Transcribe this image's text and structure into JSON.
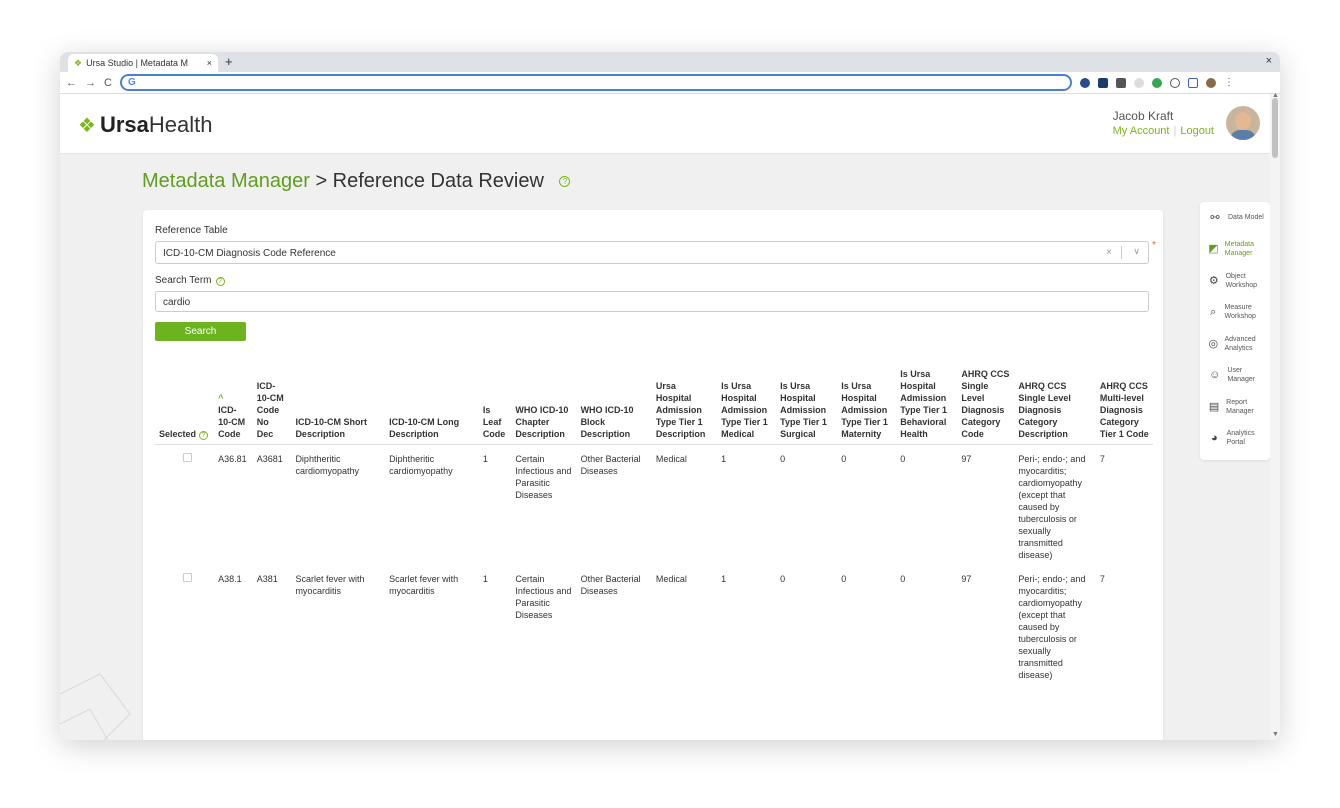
{
  "browser": {
    "tab_title": "Ursa Studio | Metadata M",
    "tab_close": "×",
    "new_tab": "+",
    "window_close": "×",
    "omnibox_text": "G",
    "back": "←",
    "forward": "→",
    "reload": "C"
  },
  "header": {
    "logo_bold": "Ursa",
    "logo_light": "Health",
    "user_name": "Jacob Kraft",
    "my_account": "My Account",
    "separator": "|",
    "logout": "Logout"
  },
  "page": {
    "title_section": "Metadata Manager",
    "title_rest": " > Reference Data Review",
    "help": "?"
  },
  "form": {
    "reference_table_label": "Reference Table",
    "reference_table_value": "ICD-10-CM Diagnosis Code Reference",
    "clear": "×",
    "chevron": "∨",
    "required_mark": "*",
    "search_term_label": "Search Term",
    "search_term_value": "cardio",
    "search_button": "Search",
    "help": "?"
  },
  "table": {
    "headers": [
      "Selected",
      "ICD-10-CM Code",
      "ICD-10-CM Code No Dec",
      "ICD-10-CM Short Description",
      "ICD-10-CM Long Description",
      "Is Leaf Code",
      "WHO ICD-10 Chapter Description",
      "WHO ICD-10 Block Description",
      "Ursa Hospital Admission Type Tier 1 Description",
      "Is Ursa Hospital Admission Type Tier 1 Medical",
      "Is Ursa Hospital Admission Type Tier 1 Surgical",
      "Is Ursa Hospital Admission Type Tier 1 Maternity",
      "Is Ursa Hospital Admission Type Tier 1 Behavioral Health",
      "AHRQ CCS Single Level Diagnosis Category Code",
      "AHRQ CCS Single Level Diagnosis Category Description",
      "AHRQ CCS Multi-level Diagnosis Category Tier 1 Code"
    ],
    "sort_indicator": "^",
    "rows": [
      [
        "",
        "A36.81",
        "A3681",
        "Diphtheritic cardiomyopathy",
        "Diphtheritic cardiomyopathy",
        "1",
        "Certain Infectious and Parasitic Diseases",
        "Other Bacterial Diseases",
        "Medical",
        "1",
        "0",
        "0",
        "0",
        "97",
        "Peri-; endo-; and myocarditis; cardiomyopathy (except that caused by tuberculosis or sexually transmitted disease)",
        "7"
      ],
      [
        "",
        "A38.1",
        "A381",
        "Scarlet fever with myocarditis",
        "Scarlet fever with myocarditis",
        "1",
        "Certain Infectious and Parasitic Diseases",
        "Other Bacterial Diseases",
        "Medical",
        "1",
        "0",
        "0",
        "0",
        "97",
        "Peri-; endo-; and myocarditis; cardiomyopathy (except that caused by tuberculosis or sexually transmitted disease)",
        "7"
      ]
    ]
  },
  "sidenav": {
    "items": [
      {
        "label": "Data Model",
        "icon": "share-nodes-icon",
        "glyph": "⚯"
      },
      {
        "label": "Metadata Manager",
        "icon": "metadata-icon",
        "glyph": "◩"
      },
      {
        "label": "Object Workshop",
        "icon": "object-workshop-icon",
        "glyph": "⚙"
      },
      {
        "label": "Measure Workshop",
        "icon": "measure-workshop-icon",
        "glyph": "⌕"
      },
      {
        "label": "Advanced Analytics",
        "icon": "advanced-analytics-icon",
        "glyph": "◎"
      },
      {
        "label": "User Manager",
        "icon": "user-manager-icon",
        "glyph": "☺"
      },
      {
        "label": "Report Manager",
        "icon": "report-manager-icon",
        "glyph": "▤"
      },
      {
        "label": "Analytics Portal",
        "icon": "analytics-portal-icon",
        "glyph": "◕"
      }
    ]
  },
  "colors": {
    "brand_green": "#6cb31f",
    "title_green": "#5f9e1e",
    "required_orange": "#e06a1f"
  }
}
